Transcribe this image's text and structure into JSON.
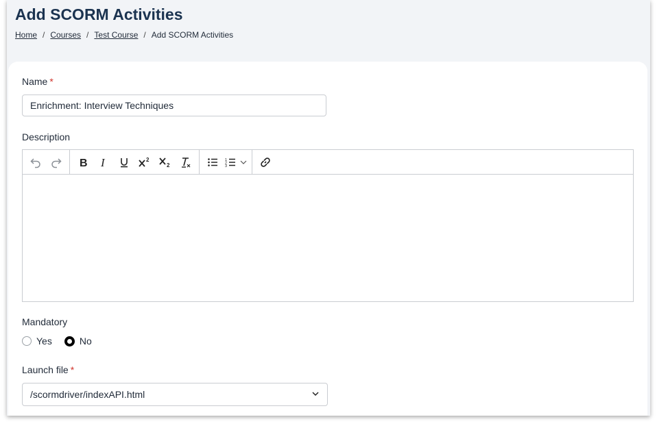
{
  "header": {
    "title": "Add SCORM Activities",
    "breadcrumb": [
      {
        "label": "Home",
        "link": true
      },
      {
        "label": "Courses",
        "link": true
      },
      {
        "label": "Test Course",
        "link": true
      },
      {
        "label": "Add SCORM Activities",
        "link": false
      }
    ],
    "separator": "/"
  },
  "form": {
    "name_label": "Name",
    "required_mark": "*",
    "name_value": "Enrichment: Interview Techniques",
    "description_label": "Description",
    "editor": {
      "toolbar_icons": [
        "undo-icon",
        "redo-icon",
        "bold-icon",
        "italic-icon",
        "underline-icon",
        "superscript-icon",
        "subscript-icon",
        "clear-format-icon",
        "bullet-list-icon",
        "numbered-list-icon",
        "chevron-down-icon",
        "link-icon"
      ],
      "content": ""
    },
    "mandatory_label": "Mandatory",
    "mandatory_options": [
      {
        "label": "Yes",
        "selected": false
      },
      {
        "label": "No",
        "selected": true
      }
    ],
    "launch_label": "Launch file",
    "launch_value": "/scormdriver/indexAPI.html"
  },
  "colors": {
    "title": "#1b3350",
    "required": "#d0342c",
    "page_bg": "#f2f4f7",
    "border": "#c9ccd1"
  }
}
